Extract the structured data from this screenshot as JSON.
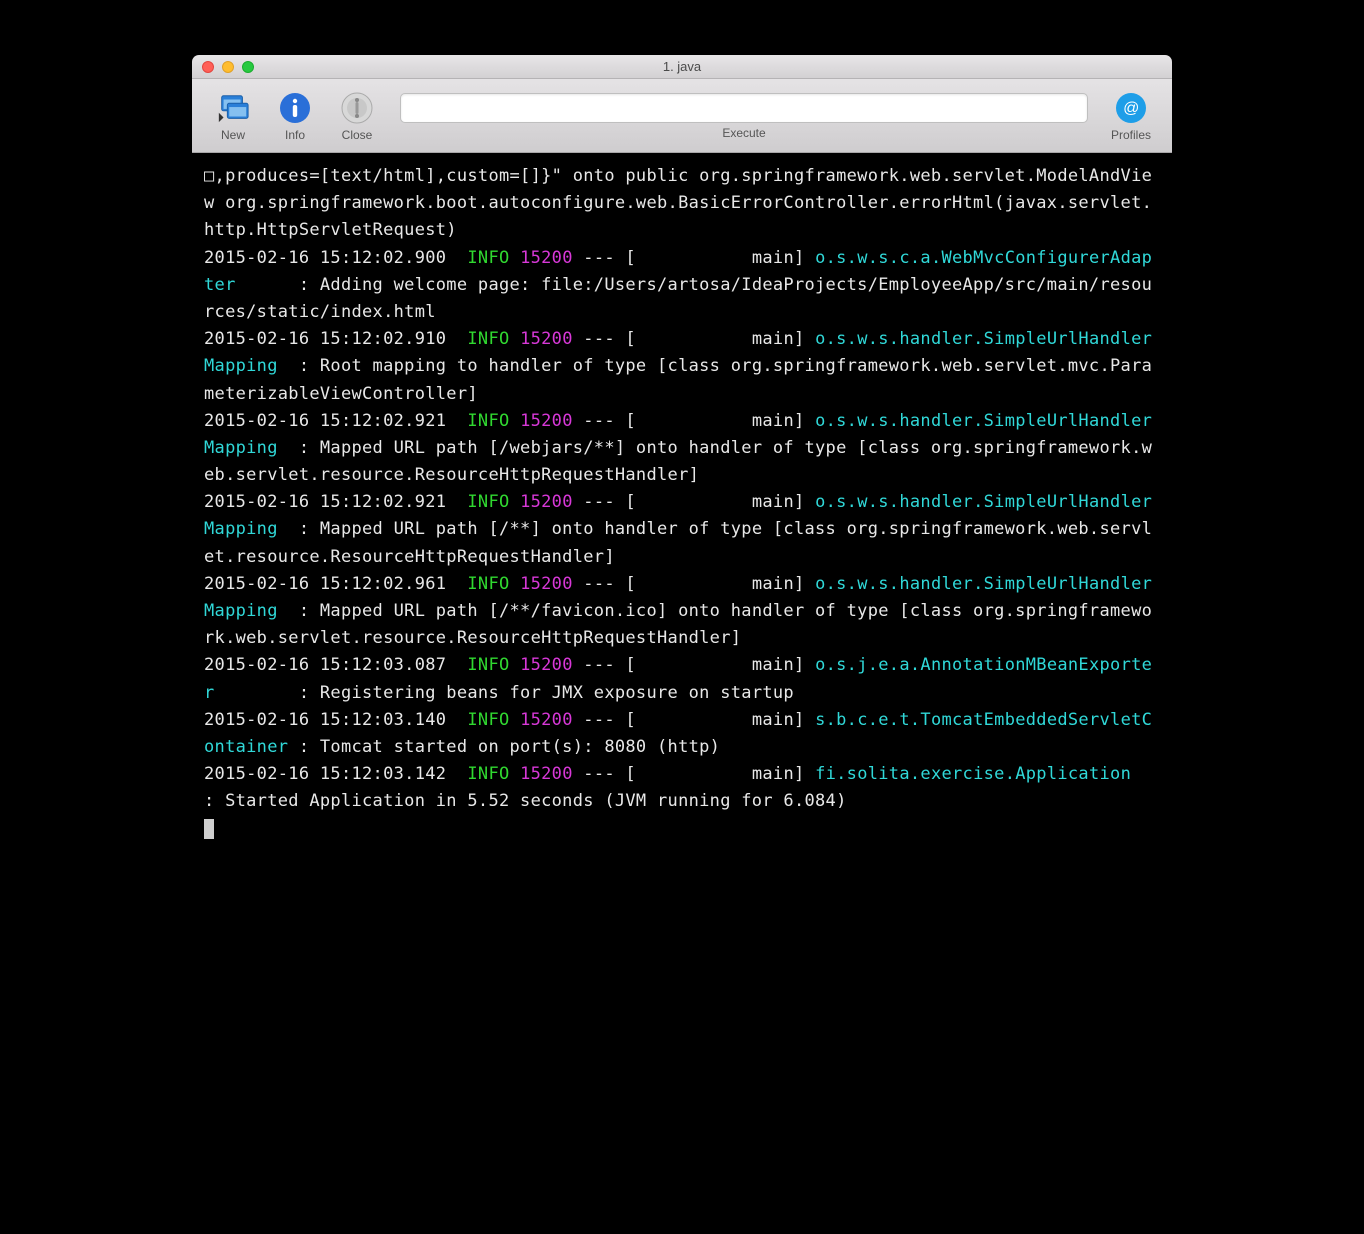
{
  "window": {
    "title": "1. java"
  },
  "toolbar": {
    "new_label": "New",
    "info_label": "Info",
    "close_label": "Close",
    "execute_label": "Execute",
    "execute_value": "",
    "profiles_label": "Profiles"
  },
  "colors": {
    "info_green": "#30d830",
    "pid_magenta": "#d838d8",
    "logger_cyan": "#30d8d8",
    "text_white": "#e8e8e8",
    "bg_black": "#000000"
  },
  "log": {
    "preamble": "□,produces=[text/html],custom=[]}\" onto public org.springframework.web.servlet.ModelAndView org.springframework.boot.autoconfigure.web.BasicErrorController.errorHtml(javax.servlet.http.HttpServletRequest)",
    "entries": [
      {
        "ts": "2015-02-16 15:12:02.900",
        "level": "INFO",
        "pid": "15200",
        "sep": " --- [           main] ",
        "logger": "o.s.w.s.c.a.WebMvcConfigurerAdapter",
        "msg": "Adding welcome page: file:/Users/artosa/IdeaProjects/EmployeeApp/src/main/resources/static/index.html"
      },
      {
        "ts": "2015-02-16 15:12:02.910",
        "level": "INFO",
        "pid": "15200",
        "sep": " --- [           main] ",
        "logger": "o.s.w.s.handler.SimpleUrlHandlerMapping",
        "msg": "Root mapping to handler of type [class org.springframework.web.servlet.mvc.ParameterizableViewController]"
      },
      {
        "ts": "2015-02-16 15:12:02.921",
        "level": "INFO",
        "pid": "15200",
        "sep": " --- [           main] ",
        "logger": "o.s.w.s.handler.SimpleUrlHandlerMapping",
        "msg": "Mapped URL path [/webjars/**] onto handler of type [class org.springframework.web.servlet.resource.ResourceHttpRequestHandler]"
      },
      {
        "ts": "2015-02-16 15:12:02.921",
        "level": "INFO",
        "pid": "15200",
        "sep": " --- [           main] ",
        "logger": "o.s.w.s.handler.SimpleUrlHandlerMapping",
        "msg": "Mapped URL path [/**] onto handler of type [class org.springframework.web.servlet.resource.ResourceHttpRequestHandler]"
      },
      {
        "ts": "2015-02-16 15:12:02.961",
        "level": "INFO",
        "pid": "15200",
        "sep": " --- [           main] ",
        "logger": "o.s.w.s.handler.SimpleUrlHandlerMapping",
        "msg": "Mapped URL path [/**/favicon.ico] onto handler of type [class org.springframework.web.servlet.resource.ResourceHttpRequestHandler]"
      },
      {
        "ts": "2015-02-16 15:12:03.087",
        "level": "INFO",
        "pid": "15200",
        "sep": " --- [           main] ",
        "logger": "o.s.j.e.a.AnnotationMBeanExporter",
        "msg": "Registering beans for JMX exposure on startup"
      },
      {
        "ts": "2015-02-16 15:12:03.140",
        "level": "INFO",
        "pid": "15200",
        "sep": " --- [           main] ",
        "logger": "s.b.c.e.t.TomcatEmbeddedServletContainer",
        "msg": "Tomcat started on port(s): 8080 (http)"
      },
      {
        "ts": "2015-02-16 15:12:03.142",
        "level": "INFO",
        "pid": "15200",
        "sep": " --- [           main] ",
        "logger": "fi.solita.exercise.Application",
        "msg": "Started Application in 5.52 seconds (JVM running for 6.084)"
      }
    ]
  }
}
